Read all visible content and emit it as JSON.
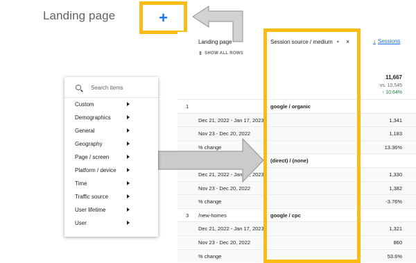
{
  "header": {
    "page_title": "Landing page",
    "add_dimension_glyph": "+"
  },
  "table": {
    "col_landing_page": "Landing page",
    "show_all_rows": "SHOW ALL ROWS",
    "col_source": "Session source / medium",
    "col_source_caret": "▾",
    "col_source_close": "×",
    "col_sessions": "Sessions",
    "sort_arrow": "↓",
    "totals": {
      "value": "11,667",
      "vs": "vs. 10,545",
      "change": "↑ 10.64%"
    },
    "rows": [
      {
        "idx": "1",
        "page": "",
        "source": "google / organic",
        "value": ""
      },
      {
        "idx": "",
        "page": "Dec 21, 2022 - Jan 17, 2023",
        "source": "",
        "value": "1,341"
      },
      {
        "idx": "",
        "page": "Nov 23 - Dec 20, 2022",
        "source": "",
        "value": "1,183"
      },
      {
        "idx": "",
        "page": "% change",
        "source": "",
        "value": "13.36%"
      },
      {
        "idx": "",
        "page": "",
        "source": "(direct) / (none)",
        "value": ""
      },
      {
        "idx": "",
        "page": "Dec 21, 2022 - Jan 17, 2023",
        "source": "",
        "value": "1,330"
      },
      {
        "idx": "",
        "page": "Nov 23 - Dec 20, 2022",
        "source": "",
        "value": "1,382"
      },
      {
        "idx": "",
        "page": "% change",
        "source": "",
        "value": "-3.76%"
      },
      {
        "idx": "3",
        "page": "/new-homes",
        "source": "google / cpc",
        "value": ""
      },
      {
        "idx": "",
        "page": "Dec 21, 2022 - Jan 17, 2023",
        "source": "",
        "value": "1,321"
      },
      {
        "idx": "",
        "page": "Nov 23 - Dec 20, 2022",
        "source": "",
        "value": "860"
      },
      {
        "idx": "",
        "page": "% change",
        "source": "",
        "value": "53.6%"
      }
    ]
  },
  "menu": {
    "search_placeholder": "Search items",
    "items": [
      "Custom",
      "Demographics",
      "General",
      "Geography",
      "Page / screen",
      "Platform / device",
      "Time",
      "Traffic source",
      "User lifetime",
      "User"
    ]
  },
  "colors": {
    "highlight": "#f9bc15",
    "accent": "#1a73e8",
    "positive": "#188038",
    "annotation_arrow": "#c9cbcd"
  }
}
